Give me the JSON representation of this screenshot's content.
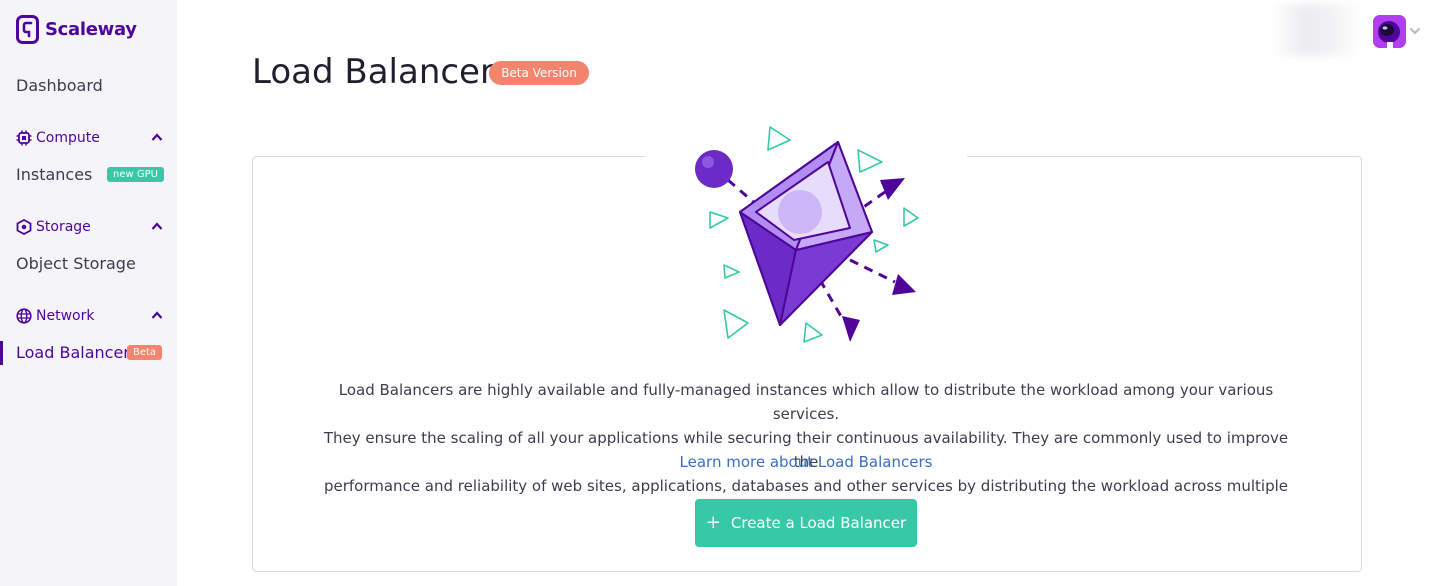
{
  "brand": {
    "name": "Scaleway",
    "color": "#4f0599"
  },
  "sidebar": {
    "dashboard": "Dashboard",
    "sections": [
      {
        "label": "Compute",
        "icon": "cpu-icon",
        "items": [
          {
            "label": "Instances",
            "badge": "new GPU"
          }
        ]
      },
      {
        "label": "Storage",
        "icon": "storage-icon",
        "items": [
          {
            "label": "Object Storage"
          }
        ]
      },
      {
        "label": "Network",
        "icon": "globe-icon",
        "items": [
          {
            "label": "Load Balancer",
            "badge": "Beta",
            "active": true
          }
        ]
      }
    ]
  },
  "header": {
    "title": "Load Balancer",
    "badge": "Beta Version"
  },
  "main": {
    "description_lines": [
      "Load Balancers are highly available and fully-managed instances which allow to distribute the workload among your various services.",
      "They ensure the scaling of all your applications while securing their continuous availability. They are commonly used to improve the",
      "performance and reliability of web sites, applications, databases and other services by distributing the workload across multiple servers."
    ],
    "learn_more": "Learn more about Load Balancers",
    "cta": {
      "icon": "+",
      "label": "Create a Load Balancer"
    }
  },
  "colors": {
    "accent": "#4f0599",
    "teal": "#37c9a7",
    "coral": "#f3846d",
    "link": "#3a6fc1"
  }
}
